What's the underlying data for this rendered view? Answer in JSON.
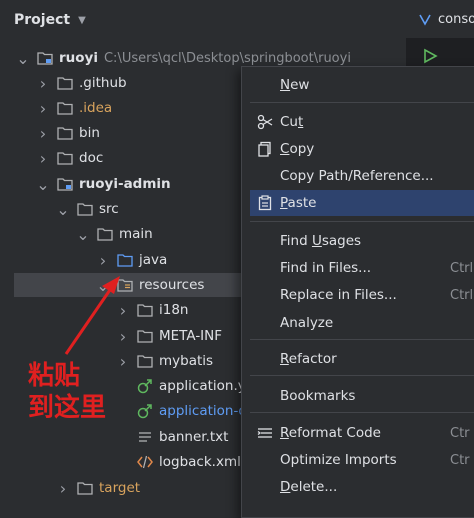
{
  "sidebar": {
    "title": "Project"
  },
  "editor": {
    "tab_label": "console"
  },
  "tree": [
    {
      "label": "ruoyi",
      "path": "C:\\Users\\qcl\\Desktop\\springboot\\ruoyi",
      "icon": "module-folder-icon",
      "expanded": true,
      "style": "bold"
    },
    {
      "label": ".github",
      "icon": "folder-icon",
      "expanded": false,
      "style": "normal"
    },
    {
      "label": ".idea",
      "icon": "folder-icon",
      "expanded": false,
      "style": "orange"
    },
    {
      "label": "bin",
      "icon": "folder-icon",
      "expanded": false,
      "style": "normal"
    },
    {
      "label": "doc",
      "icon": "folder-icon",
      "expanded": false,
      "style": "normal"
    },
    {
      "label": "ruoyi-admin",
      "icon": "module-folder-icon",
      "expanded": true,
      "style": "bold"
    },
    {
      "label": "src",
      "icon": "folder-icon",
      "expanded": true,
      "style": "normal"
    },
    {
      "label": "main",
      "icon": "folder-icon",
      "expanded": true,
      "style": "normal"
    },
    {
      "label": "java",
      "icon": "source-folder-icon",
      "expanded": false,
      "style": "normal"
    },
    {
      "label": "resources",
      "icon": "resources-folder-icon",
      "expanded": true,
      "style": "normal",
      "selected": true
    },
    {
      "label": "i18n",
      "icon": "folder-icon",
      "expanded": false,
      "style": "normal"
    },
    {
      "label": "META-INF",
      "icon": "folder-icon",
      "expanded": false,
      "style": "normal"
    },
    {
      "label": "mybatis",
      "icon": "folder-icon",
      "expanded": false,
      "style": "normal"
    },
    {
      "label": "application.yml",
      "icon": "yaml-file-icon",
      "style": "normal"
    },
    {
      "label": "application-druid.yml",
      "icon": "yaml-file-icon",
      "style": "blue"
    },
    {
      "label": "banner.txt",
      "icon": "text-file-icon",
      "style": "normal"
    },
    {
      "label": "logback.xml",
      "icon": "xml-file-icon",
      "style": "normal"
    },
    {
      "label": "target",
      "icon": "folder-icon",
      "expanded": false,
      "style": "orange"
    }
  ],
  "context_menu": {
    "items": [
      {
        "label": "New",
        "mnemonic": "N",
        "icon": ""
      },
      {
        "label": "Cut",
        "mnemonic": "t",
        "icon": "scissors-icon"
      },
      {
        "label": "Copy",
        "mnemonic": "C",
        "icon": "copy-icon"
      },
      {
        "label": "Copy Path/Reference...",
        "icon": ""
      },
      {
        "label": "Paste",
        "mnemonic": "P",
        "icon": "paste-icon",
        "highlighted": true
      },
      {
        "label": "Find Usages",
        "mnemonic": "U",
        "icon": ""
      },
      {
        "label": "Find in Files...",
        "icon": "",
        "shortcut": "Ctrl+"
      },
      {
        "label": "Replace in Files...",
        "icon": "",
        "shortcut": "Ctrl+"
      },
      {
        "label": "Analyze",
        "icon": ""
      },
      {
        "label": "Refactor",
        "mnemonic": "R",
        "icon": ""
      },
      {
        "label": "Bookmarks",
        "icon": ""
      },
      {
        "label": "Reformat Code",
        "mnemonic": "R",
        "icon": "reformat-icon",
        "shortcut": "Ctr"
      },
      {
        "label": "Optimize Imports",
        "icon": "",
        "shortcut": "Ctr"
      },
      {
        "label": "Delete...",
        "mnemonic": "D",
        "icon": ""
      }
    ]
  },
  "annotation": {
    "line1": "粘贴",
    "line2": "到这里"
  },
  "colors": {
    "background": "#2b2d30",
    "highlight": "#2e436e",
    "selection": "#43454a",
    "annotation": "#e02020",
    "excluded_folder": "#d8a35d",
    "modified_file": "#5f9df5"
  }
}
